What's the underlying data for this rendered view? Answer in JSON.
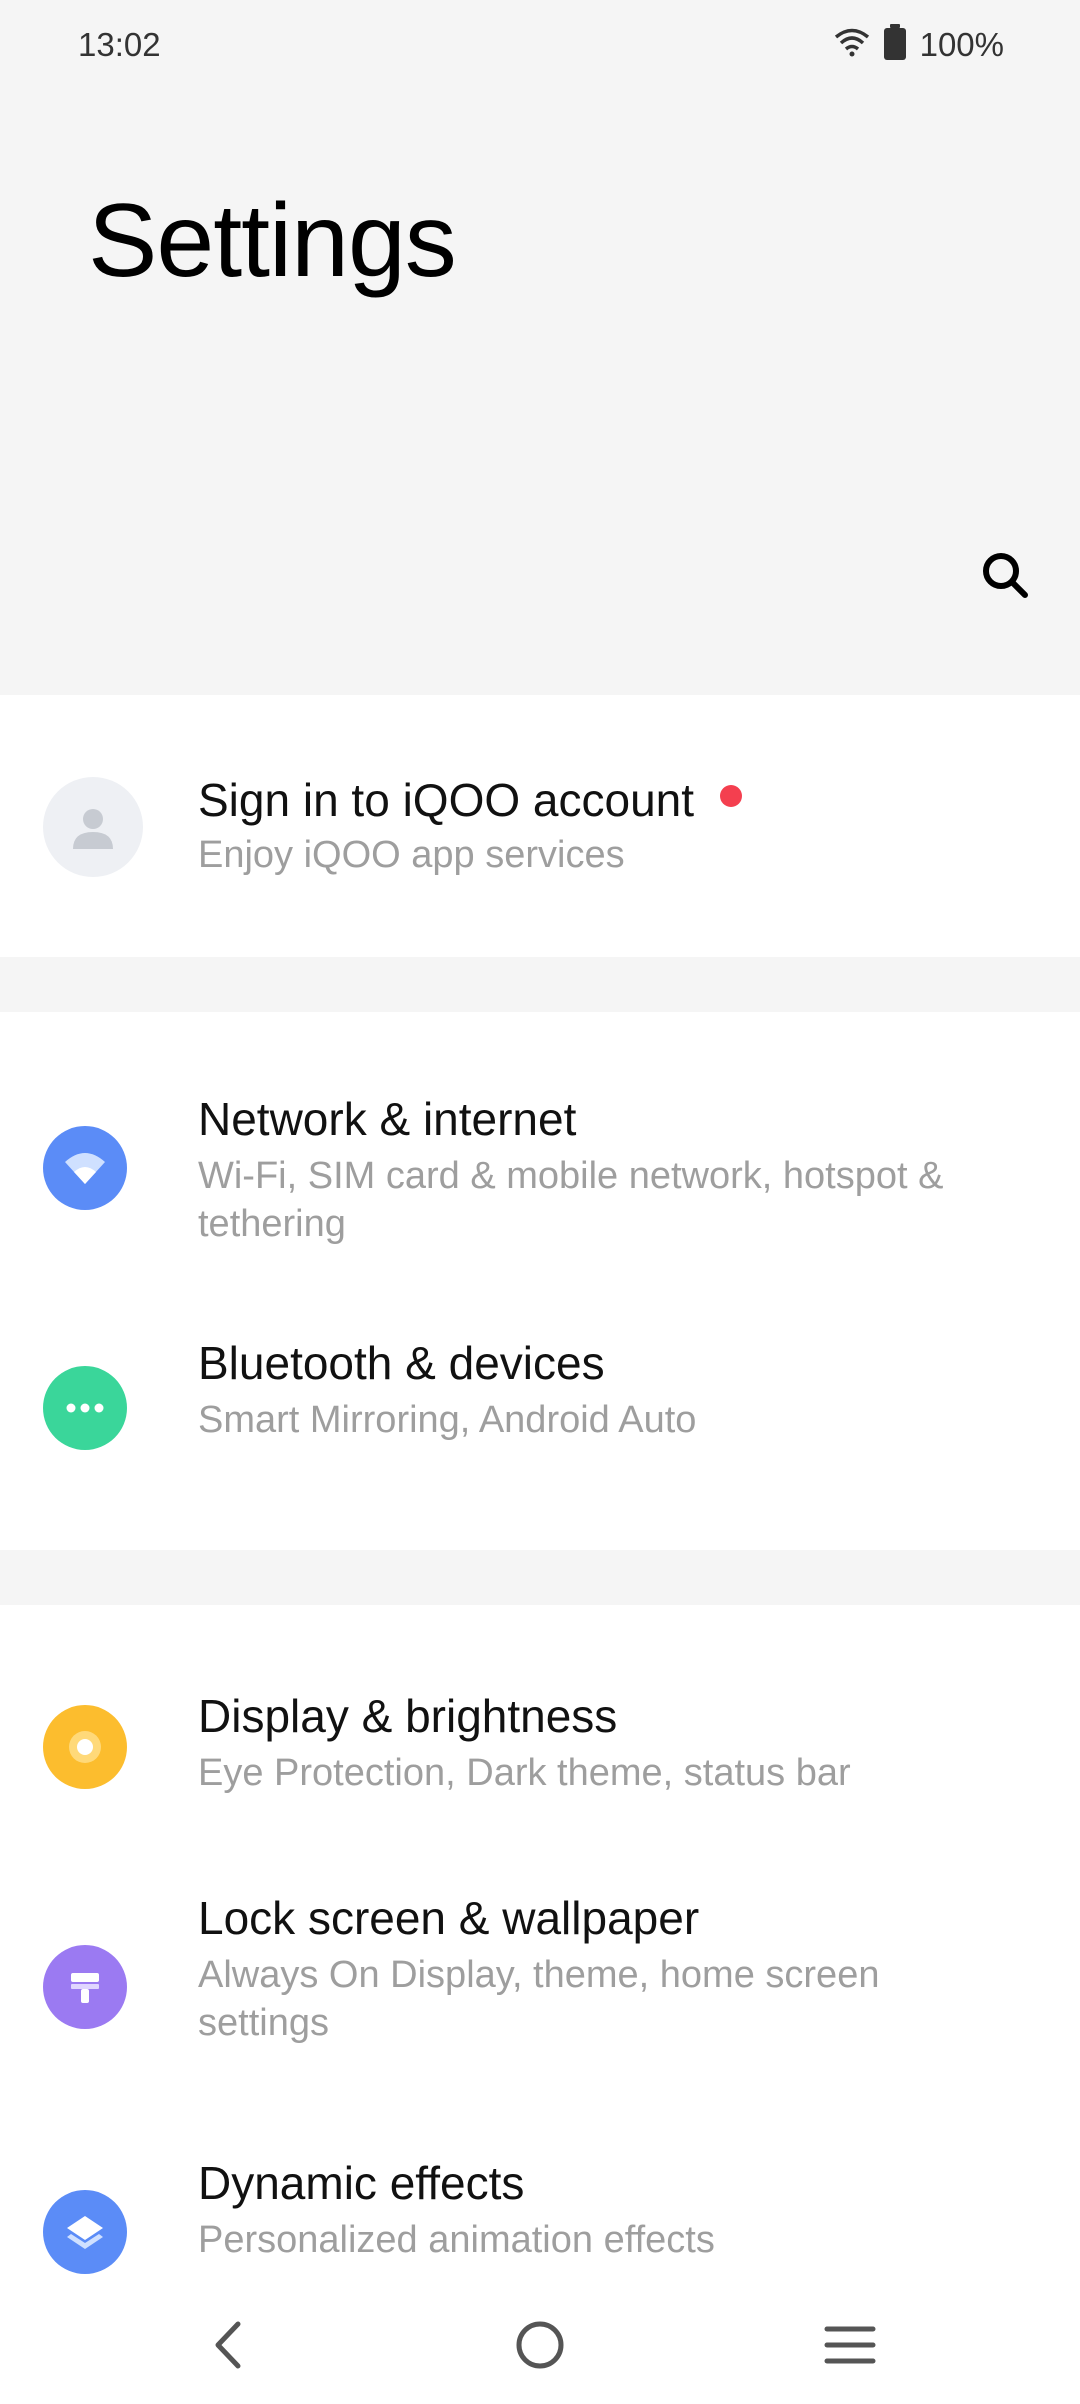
{
  "status_bar": {
    "time": "13:02",
    "battery": "100%",
    "wifi_icon": "wifi-icon",
    "battery_icon": "battery-icon"
  },
  "header": {
    "title": "Settings",
    "search_icon": "search-icon"
  },
  "account": {
    "title": "Sign in to iQOO account",
    "subtitle": "Enjoy iQOO app services",
    "icon": "avatar-icon",
    "dot_color": "#f43f4f"
  },
  "group1": [
    {
      "title": "Network & internet",
      "subtitle": "Wi-Fi, SIM card & mobile network, hotspot & tethering",
      "icon": "wifi-icon",
      "color": "#5b8cf7"
    },
    {
      "title": "Bluetooth & devices",
      "subtitle": "Smart Mirroring, Android Auto",
      "icon": "more-dots-icon",
      "color": "#3ad69a"
    }
  ],
  "group2": [
    {
      "title": "Display & brightness",
      "subtitle": "Eye Protection, Dark theme, status bar",
      "icon": "brightness-icon",
      "color": "#fcbd2e"
    },
    {
      "title": "Lock screen & wallpaper",
      "subtitle": "Always On Display, theme, home screen settings",
      "icon": "brush-icon",
      "color": "#9b7af2"
    },
    {
      "title": "Dynamic effects",
      "subtitle": "Personalized animation effects",
      "icon": "layers-icon",
      "color": "#5b8cf7"
    }
  ],
  "nav": {
    "back_icon": "back-icon",
    "home_icon": "home-icon",
    "menu_icon": "menu-icon"
  }
}
